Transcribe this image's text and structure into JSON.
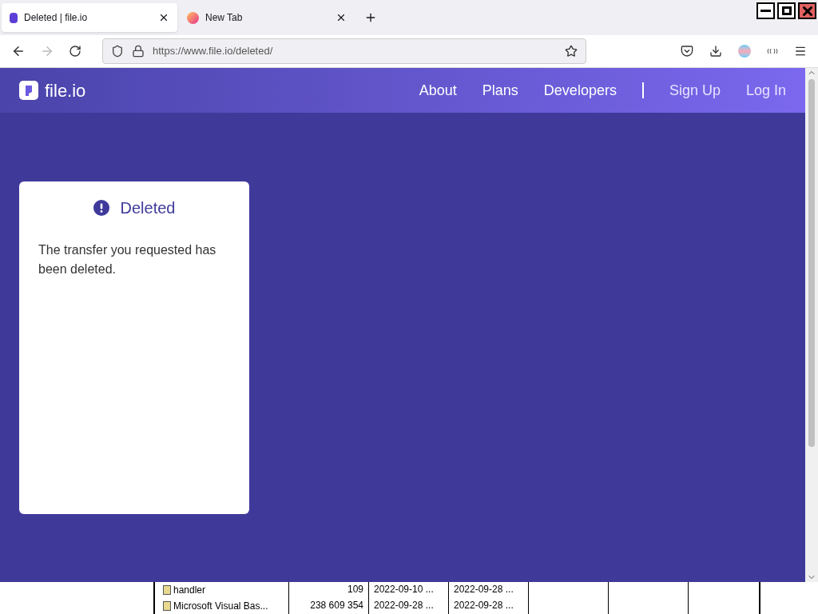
{
  "tabs": [
    {
      "title": "Deleted | file.io",
      "selected": true,
      "kind": "site"
    },
    {
      "title": "New Tab",
      "selected": false,
      "kind": "browser"
    }
  ],
  "address": "https://www.file.io/deleted/",
  "site": {
    "logo": "file.io",
    "nav": [
      "About",
      "Plans",
      "Developers"
    ],
    "auth": [
      "Sign Up",
      "Log In"
    ]
  },
  "card": {
    "title": "Deleted",
    "message": "The transfer you requested has been deleted."
  },
  "background_window": {
    "rows": [
      {
        "name": "handler",
        "size": "109",
        "column_3": "2022-09-10 ...",
        "column_4": "2022-09-28 ..."
      },
      {
        "name": "Microsoft Visual Bas...",
        "size": "238 609 354",
        "column_3": "2022-09-28 ...",
        "column_4": "2022-09-28 ..."
      }
    ]
  }
}
